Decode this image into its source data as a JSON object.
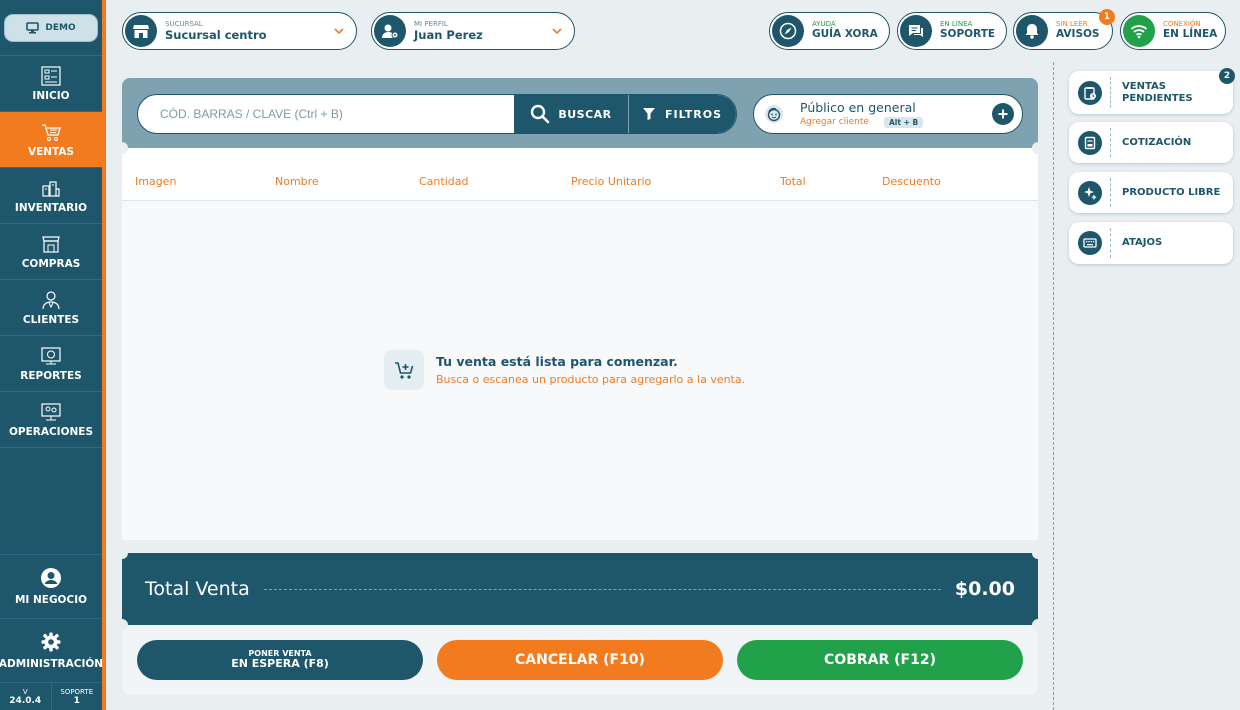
{
  "sidebar": {
    "demo_label": "DEMO",
    "items": [
      {
        "label": "INICIO",
        "icon": "dashboard-icon"
      },
      {
        "label": "VENTAS",
        "icon": "cart-icon",
        "active": true
      },
      {
        "label": "INVENTARIO",
        "icon": "inventory-icon"
      },
      {
        "label": "COMPRAS",
        "icon": "store-icon"
      },
      {
        "label": "CLIENTES",
        "icon": "client-icon"
      },
      {
        "label": "REPORTES",
        "icon": "report-icon"
      },
      {
        "label": "OPERACIONES",
        "icon": "operations-icon"
      }
    ],
    "bottom": [
      {
        "label": "MI NEGOCIO",
        "icon": "user-circle-icon"
      },
      {
        "label": "ADMINISTRACIÓN",
        "icon": "gear-icon"
      }
    ],
    "version_label": "V",
    "version": "24.0.4",
    "support_label": "SOPORTE",
    "support_value": "1"
  },
  "topbar": {
    "branch": {
      "small": "SUCURSAL",
      "value": "Sucursal centro"
    },
    "profile": {
      "small": "MI PERFIL",
      "value": "Juan Perez"
    },
    "guide": {
      "small": "AYUDA",
      "value": "GUÍA XORA"
    },
    "support": {
      "small": "EN LINEA",
      "value": "SOPORTE"
    },
    "notices": {
      "small": "SIN LEER",
      "value": "AVISOS",
      "badge": "1"
    },
    "connection": {
      "small": "CONEXIÓN",
      "value": "EN LÍNEA"
    }
  },
  "search": {
    "placeholder": "CÓD. BARRAS / CLAVE (Ctrl + B)",
    "search_label": "BUSCAR",
    "filter_label": "FILTROS"
  },
  "client": {
    "name": "Público en general",
    "add_label": "Agregar cliente",
    "shortcut": "Alt + B"
  },
  "table": {
    "columns": [
      "Imagen",
      "Nombre",
      "Cantidad",
      "Precio Unitario",
      "Total",
      "Descuento"
    ],
    "empty_title": "Tu venta está lista para comenzar.",
    "empty_subtitle": "Busca o escanea un producto para agregarlo a la venta."
  },
  "totals": {
    "label": "Total Venta",
    "value": "$0.00"
  },
  "actions": {
    "hold_small": "PONER VENTA",
    "hold_big": "EN ESPERA (F8)",
    "cancel": "CANCELAR (F10)",
    "pay": "COBRAR (F12)"
  },
  "right_panel": [
    {
      "label": "VENTAS PENDIENTES",
      "badge": "2"
    },
    {
      "label": "COTIZACIÓN"
    },
    {
      "label": "PRODUCTO LIBRE"
    },
    {
      "label": "ATAJOS"
    }
  ],
  "colors": {
    "primary": "#1e566b",
    "accent": "#f27b1f",
    "success": "#21a14a",
    "background": "#e9eff1"
  }
}
